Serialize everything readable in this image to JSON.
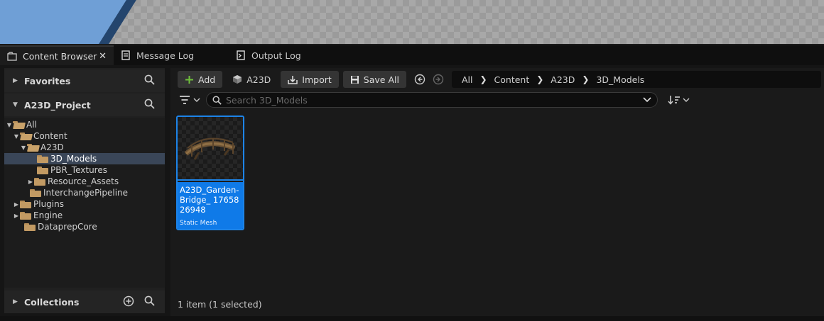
{
  "tabs": [
    {
      "label": "Content Browser",
      "active": true
    },
    {
      "label": "Message Log",
      "active": false
    },
    {
      "label": "Output Log",
      "active": false
    }
  ],
  "tab_close": "✕",
  "sidebar": {
    "favorites": "Favorites",
    "project": "A23D_Project",
    "collections": "Collections",
    "tree": [
      {
        "label": "All",
        "depth": 0,
        "expanded": true,
        "selected": false
      },
      {
        "label": "Content",
        "depth": 1,
        "expanded": true,
        "selected": false
      },
      {
        "label": "A23D",
        "depth": 2,
        "expanded": true,
        "selected": false
      },
      {
        "label": "3D_Models",
        "depth": 3,
        "expanded": false,
        "selected": true
      },
      {
        "label": "PBR_Textures",
        "depth": 3,
        "expanded": false,
        "selected": false
      },
      {
        "label": "Resource_Assets",
        "depth": 3,
        "expanded": false,
        "selected": false,
        "has_children": true
      },
      {
        "label": "InterchangePipeline",
        "depth": 2,
        "expanded": false,
        "selected": false
      },
      {
        "label": "Plugins",
        "depth": 1,
        "expanded": false,
        "selected": false,
        "has_children": true
      },
      {
        "label": "Engine",
        "depth": 1,
        "expanded": false,
        "selected": false,
        "has_children": true
      },
      {
        "label": "DataprepCore",
        "depth": 1,
        "expanded": false,
        "selected": false
      }
    ]
  },
  "toolbar": {
    "add": "Add",
    "a23d": "A23D",
    "import": "Import",
    "save_all": "Save All"
  },
  "breadcrumb": [
    "All",
    "Content",
    "A23D",
    "3D_Models"
  ],
  "search": {
    "placeholder": "Search 3D_Models"
  },
  "assets": [
    {
      "name": "A23D_Garden-Bridge_ 1765826948",
      "type": "Static Mesh",
      "selected": true
    }
  ],
  "status": "1 item (1 selected)",
  "colors": {
    "accent": "#0f7ae8",
    "folder": "#c29a63",
    "add_icon": "#6fbf3c"
  }
}
